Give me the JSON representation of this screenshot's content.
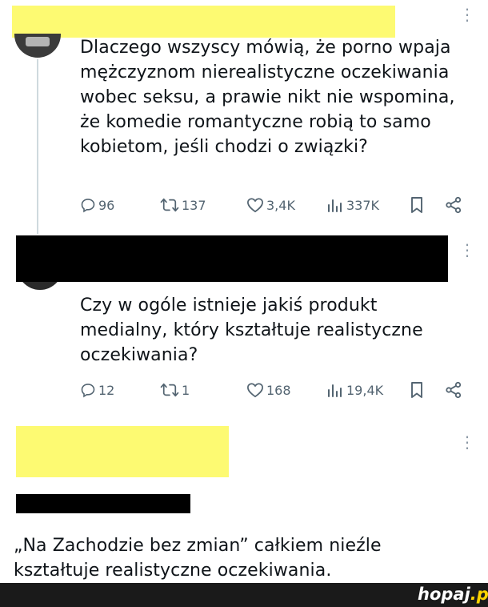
{
  "tweets": [
    {
      "text": "Dlaczego wszyscy mówią, że porno wpaja mężczyznom nierealistyczne oczekiwania wobec seksu, a prawie nikt nie wspomina, że komedie romantyczne robią to samo kobietom, jeśli chodzi o związki?",
      "replies": "96",
      "retweets": "137",
      "likes": "3,4K",
      "views": "337K"
    },
    {
      "text": "Czy w ogóle istnieje jakiś produkt medialny, który kształtuje realistyczne oczekiwania?",
      "replies": "12",
      "retweets": "1",
      "likes": "168",
      "views": "19,4K"
    }
  ],
  "comment": {
    "text": "„Na Zachodzie bez zmian” całkiem nieźle kształtuje realistyczne oczekiwania."
  },
  "footer": {
    "logo_main": "hopaj",
    "logo_tld": ".pl"
  },
  "icons": {
    "reply": "reply-icon",
    "retweet": "retweet-icon",
    "like": "heart-icon",
    "views": "views-icon",
    "bookmark": "bookmark-icon",
    "share": "share-icon",
    "more": "more-icon"
  },
  "colors": {
    "redaction_yellow": "#fdfa72",
    "redaction_black": "#000000",
    "action_gray": "#536471",
    "footer_bg": "#1a1a1a",
    "logo_accent": "#ffd400"
  }
}
